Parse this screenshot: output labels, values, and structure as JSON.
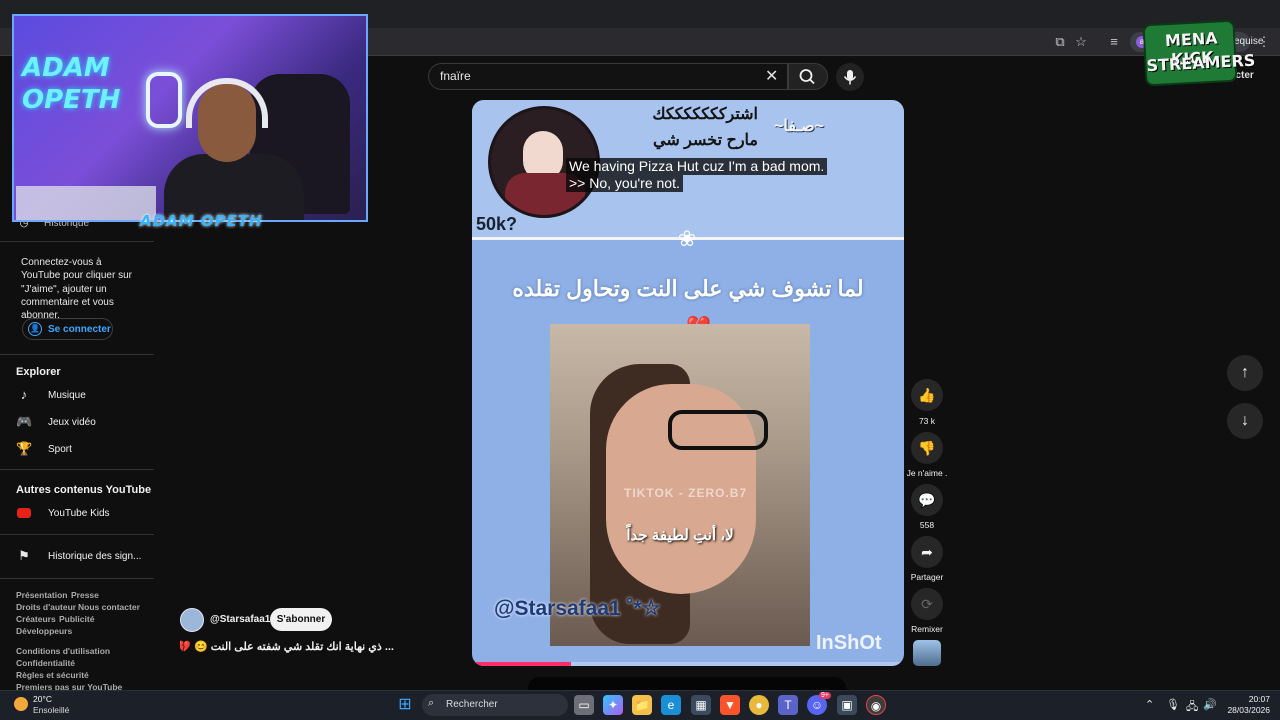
{
  "browser": {
    "profile_label": "a",
    "profile_text": "equise",
    "menu_icon": "kebab-menu-icon"
  },
  "header": {
    "search_value": "fnaïre",
    "connect_label": "connecter"
  },
  "badge": {
    "line1": "MENA KICK",
    "line2": "STREAMERS"
  },
  "webcam": {
    "title": "ADAM OPETH",
    "logo": "ADAM OPETH"
  },
  "sidebar": {
    "history_partial": "Historique",
    "signin_prompt": "Connectez-vous à YouTube pour cliquer sur \"J'aime\", ajouter un commentaire et vous abonner.",
    "signin_label": "Se connecter",
    "explore_heading": "Explorer",
    "explore_items": [
      {
        "label": "Musique",
        "icon": "music-note-icon"
      },
      {
        "label": "Jeux vidéo",
        "icon": "gamepad-icon"
      },
      {
        "label": "Sport",
        "icon": "trophy-icon"
      }
    ],
    "more_heading": "Autres contenus YouTube",
    "youtube_kids": "YouTube Kids",
    "report_history": "Historique des sign...",
    "footer_links_1": [
      "Présentation",
      "Presse"
    ],
    "footer_links_2": [
      "Droits d'auteur",
      "Nous contacter"
    ],
    "footer_links_3": [
      "Créateurs",
      "Publicité"
    ],
    "footer_links_4": [
      "Développeurs"
    ],
    "footer_links_5": [
      "Conditions d'utilisation"
    ],
    "footer_links_6": [
      "Confidentialité"
    ],
    "footer_links_7": [
      "Règles et sécurité"
    ],
    "footer_links_8": [
      "Premiers pas sur YouTube"
    ]
  },
  "video": {
    "arabic_top_1": "اشتركككككككك",
    "arabic_top_2": "مارح تخسر شي",
    "arabic_top_3": "~صـفا~",
    "counter": "50k?",
    "caption": "لما تشوف شي على النت وتحاول تقلده",
    "watermark": "TIKTOK - ZERO.B7",
    "subtitle": "لا، أنتِ لطيفة جداً",
    "handle": "@Starsafaa1 ˚*☆",
    "inshot": "InShOt",
    "progress_fraction": 0.23,
    "captions": [
      "We having Pizza Hut cuz I'm a bad mom.",
      ">> No, you're not."
    ]
  },
  "actions": {
    "like_count": "73 k",
    "dislike_label": "Je n'aime .",
    "comments_count": "558",
    "share_label": "Partager",
    "remix_label": "Remixer"
  },
  "channel": {
    "name": "@Starsafaa1",
    "subscribe_label": "S'abonner",
    "title": "... ذي نهاية انك تقلد شي شفته على النت 😊 💔"
  },
  "taskbar": {
    "temperature": "20°C",
    "condition": "Ensoleillé",
    "search_placeholder": "Rechercher",
    "time": "20:07",
    "date": "28/03/2026",
    "notification_count": "9+"
  }
}
